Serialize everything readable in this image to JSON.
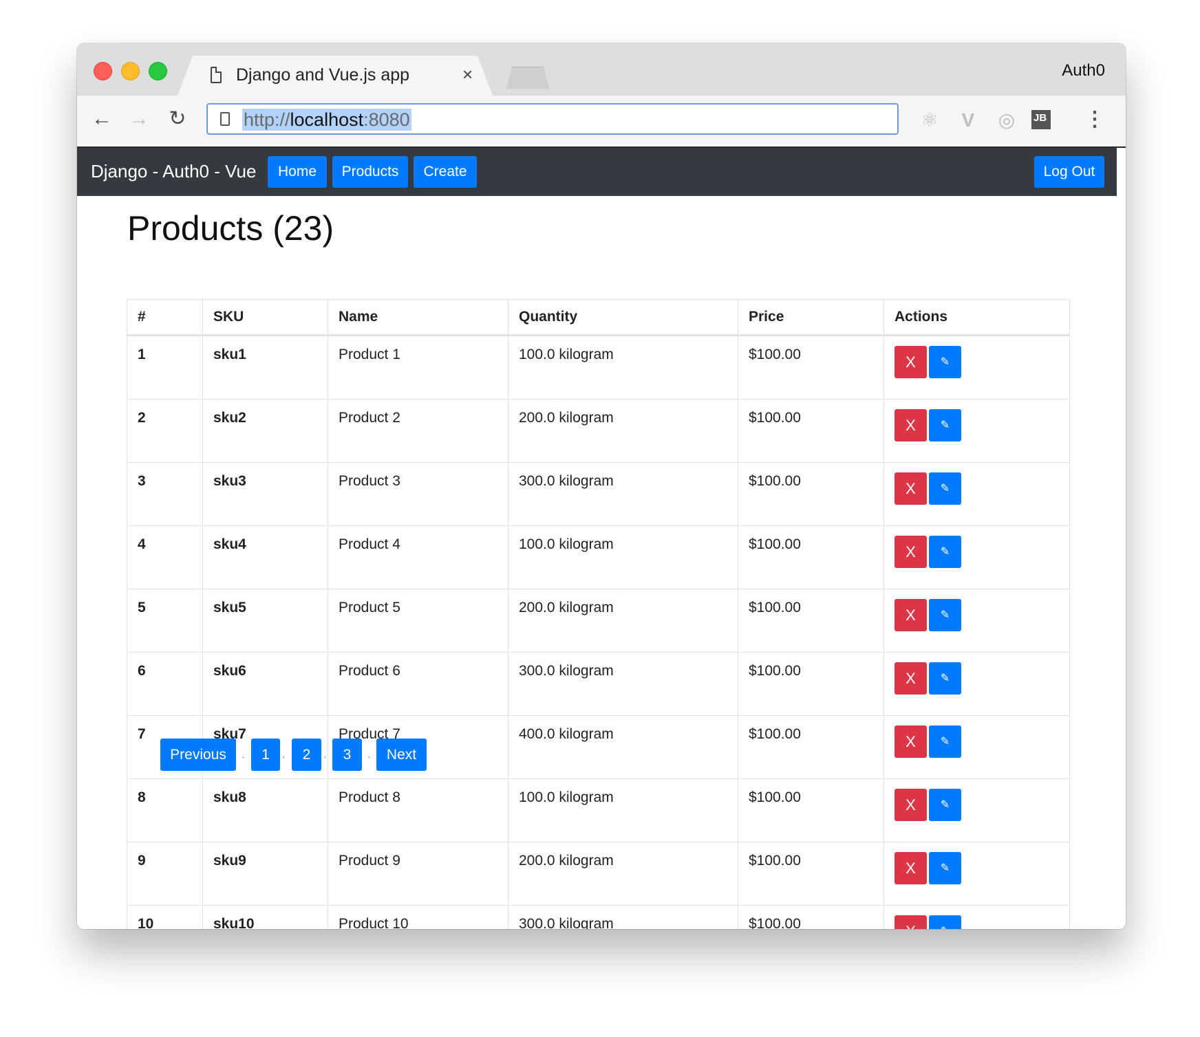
{
  "browser": {
    "tab_title": "Django and Vue.js app",
    "tab_close": "×",
    "profile": "Auth0",
    "url_scheme": "http://",
    "url_host": "localhost",
    "url_port": ":8080",
    "back_glyph": "←",
    "forward_glyph": "→",
    "reload_glyph": "↻",
    "menu_glyph": "⋮",
    "extensions": {
      "react": "⚛",
      "vue": "V",
      "redux": "◎",
      "jb": "JB"
    }
  },
  "navbar": {
    "brand": "Django - Auth0 - Vue",
    "home": "Home",
    "products": "Products",
    "create": "Create",
    "logout": "Log Out"
  },
  "page": {
    "title": "Products (23)"
  },
  "table": {
    "headers": [
      "#",
      "SKU",
      "Name",
      "Quantity",
      "Price",
      "Actions"
    ],
    "delete_label": "X",
    "edit_label": "✎",
    "rows": [
      {
        "num": "1",
        "sku": "sku1",
        "name": "Product 1",
        "quantity": "100.0 kilogram",
        "price": "$100.00"
      },
      {
        "num": "2",
        "sku": "sku2",
        "name": "Product 2",
        "quantity": "200.0 kilogram",
        "price": "$100.00"
      },
      {
        "num": "3",
        "sku": "sku3",
        "name": "Product 3",
        "quantity": "300.0 kilogram",
        "price": "$100.00"
      },
      {
        "num": "4",
        "sku": "sku4",
        "name": "Product 4",
        "quantity": "100.0 kilogram",
        "price": "$100.00"
      },
      {
        "num": "5",
        "sku": "sku5",
        "name": "Product 5",
        "quantity": "200.0 kilogram",
        "price": "$100.00"
      },
      {
        "num": "6",
        "sku": "sku6",
        "name": "Product 6",
        "quantity": "300.0 kilogram",
        "price": "$100.00"
      },
      {
        "num": "7",
        "sku": "sku7",
        "name": "Product 7",
        "quantity": "400.0 kilogram",
        "price": "$100.00"
      },
      {
        "num": "8",
        "sku": "sku8",
        "name": "Product 8",
        "quantity": "100.0 kilogram",
        "price": "$100.00"
      },
      {
        "num": "9",
        "sku": "sku9",
        "name": "Product 9",
        "quantity": "200.0 kilogram",
        "price": "$100.00"
      },
      {
        "num": "10",
        "sku": "sku10",
        "name": "Product 10",
        "quantity": "300.0 kilogram",
        "price": "$100.00"
      }
    ]
  },
  "pagination": {
    "previous": "Previous",
    "pages": [
      "1",
      "2",
      "3"
    ],
    "next": "Next",
    "separator": "·"
  },
  "colors": {
    "navbar_bg": "#343a40",
    "primary": "#007bff",
    "danger": "#dc3545"
  }
}
